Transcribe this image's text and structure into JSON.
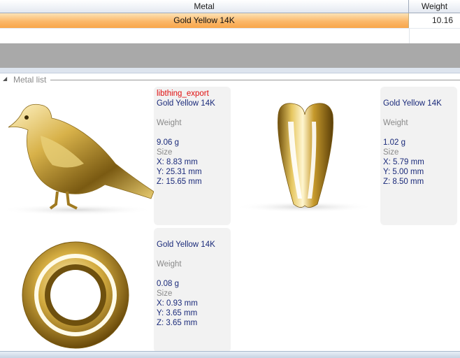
{
  "grid": {
    "columns": [
      "Metal",
      "Weight"
    ],
    "rows": [
      {
        "metal": "Gold Yellow 14K",
        "weight": "10.16"
      }
    ]
  },
  "section": {
    "title": "Metal list"
  },
  "cards": [
    {
      "export_label": "libthing_export",
      "metal": "Gold Yellow 14K",
      "weight_label": "Weight",
      "weight": "9.06 g",
      "size_label": "Size",
      "x": "X: 8.83 mm",
      "y": "Y: 25.31 mm",
      "z": "Z: 15.65 mm",
      "icon": "bird-figurine"
    },
    {
      "metal": "Gold Yellow 14K",
      "weight_label": "Weight",
      "weight": "1.02 g",
      "size_label": "Size",
      "x": "X: 5.79 mm",
      "y": "Y: 5.00 mm",
      "z": "Z: 8.50 mm",
      "icon": "bail-loop"
    },
    {
      "metal": "Gold Yellow 14K",
      "weight_label": "Weight",
      "weight": "0.08 g",
      "size_label": "Size",
      "x": "X: 0.93 mm",
      "y": "Y: 3.65 mm",
      "z": "Z: 3.65 mm",
      "icon": "jump-ring"
    }
  ],
  "colors": {
    "selected_row": "#fbb86a",
    "metal_text": "#1a2a7a",
    "export_text": "#e01010",
    "gold": "#c9a33a"
  }
}
